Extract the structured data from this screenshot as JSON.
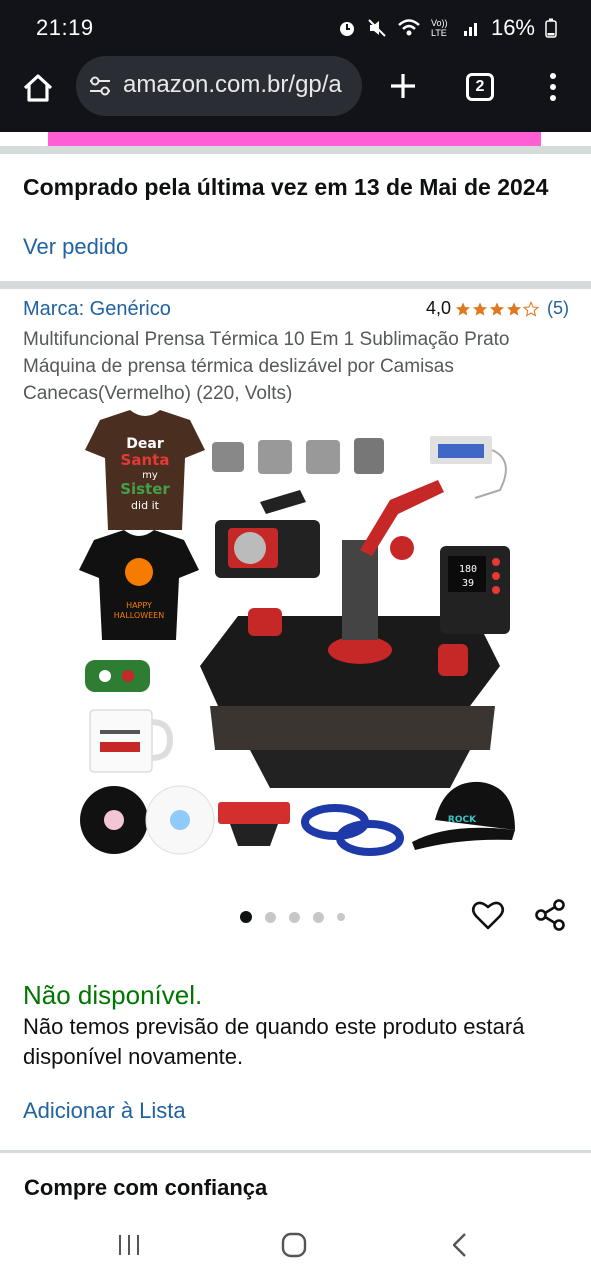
{
  "status_bar": {
    "time": "21:19",
    "battery": "16%",
    "icons": [
      "alarm-icon",
      "mute-icon",
      "wifi-icon",
      "volte-icon",
      "signal-icon",
      "battery-icon"
    ],
    "volte_label": "Vo)) LTE"
  },
  "browser": {
    "url": "amazon.com.br/gp/a",
    "tab_count": "2"
  },
  "page": {
    "purchase_info": "Comprado pela última vez em 13 de Mai de 2024",
    "view_order": "Ver pedido",
    "brand": "Marca: Genérico",
    "rating_value": "4,0",
    "rating_stars": 4,
    "rating_count": "(5)",
    "product_title": "Multifuncional Prensa Térmica 10 Em 1 Sublimação Prato Máquina de prensa térmica deslizável por Camisas Canecas(Vermelho) (220, Volts)",
    "carousel": {
      "total": 5,
      "active_index": 0
    },
    "availability": "Não disponível.",
    "availability_note": "Não temos previsão de quando este produto estará disponível novamente.",
    "add_to_list": "Adicionar à Lista",
    "section_heading": "Compre com confiança"
  },
  "image_text": {
    "shirt1_line1": "Dear",
    "shirt1_line2": "Santa",
    "shirt1_line3": "my",
    "shirt1_line4": "Sister",
    "shirt1_line5": "did it",
    "shirt2_line1": "HAPPY",
    "shirt2_line2": "HALLOWEEN",
    "cap_text": "ROCK",
    "display_temp": "180",
    "display_time": "39"
  },
  "colors": {
    "link": "#2162a1",
    "available": "#007600",
    "star": "#de7921",
    "chrome": "#111318"
  }
}
